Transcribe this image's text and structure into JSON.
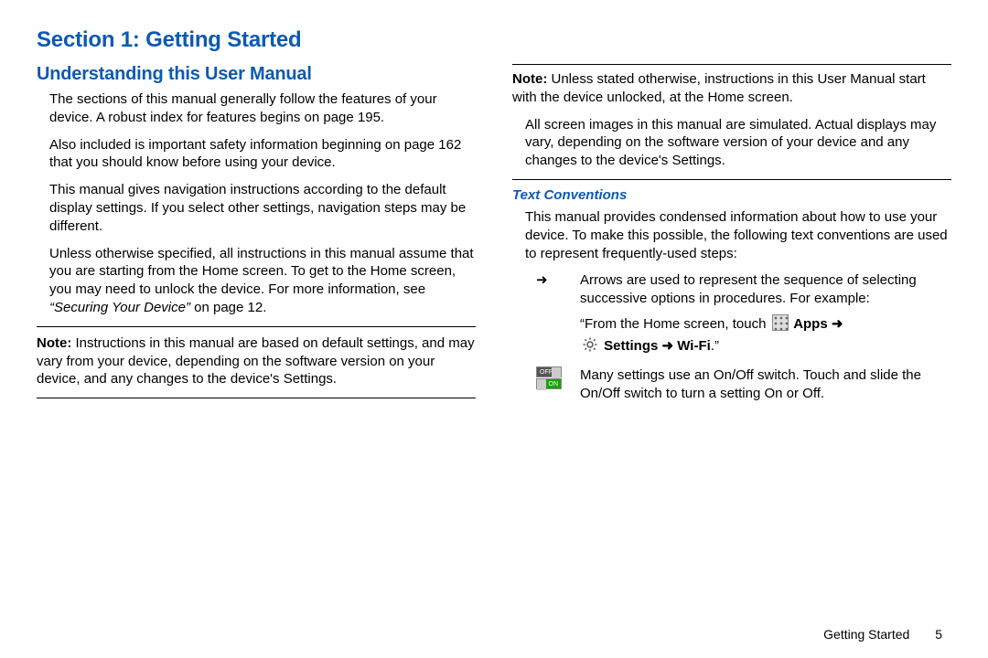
{
  "section_title": "Section 1: Getting Started",
  "left": {
    "heading": "Understanding this User Manual",
    "p1": "The sections of this manual generally follow the features of your device. A robust index for features begins on page 195.",
    "p2": "Also included is important safety information beginning on page 162 that you should know before using your device.",
    "p3": "This manual gives navigation instructions according to the default display settings. If you select other settings, navigation steps may be different.",
    "p4_a": "Unless otherwise specified, all instructions in this manual assume that you are starting from the Home screen. To get to the Home screen, you may need to unlock the device. For more information, see ",
    "p4_ref": "“Securing Your Device”",
    "p4_b": " on page 12.",
    "note_label": "Note:",
    "note_text": " Instructions in this manual are based on default settings, and may vary from your device, depending on the software version on your device, and any changes to the device's Settings."
  },
  "right": {
    "note_label": "Note:",
    "note2_text": " Unless stated otherwise, instructions in this User Manual start with the device unlocked, at the Home screen.",
    "p_sim": "All screen images in this manual are simulated. Actual displays may vary, depending on the software version of your device and any changes to the device's Settings.",
    "conv_heading": "Text Conventions",
    "conv_intro": "This manual provides condensed information about how to use your device. To make this possible, the following text conventions are used to represent frequently-used steps:",
    "arrow_sym": "➜",
    "arrow_text": "Arrows are used to represent the sequence of selecting successive options in procedures. For example:",
    "example_a": "“From the Home screen, touch ",
    "example_apps": " Apps ",
    "example_arrow1": "➜",
    "example_settings": " Settings ",
    "example_arrow2": "➜",
    "example_wifi": " Wi-Fi",
    "example_end": ".”",
    "switch_text": "Many settings use an On/Off switch. Touch and slide the On/Off switch to turn a setting On or Off.",
    "switch_off": "OFF",
    "switch_on": "ON"
  },
  "footer": {
    "chapter": "Getting Started",
    "page": "5"
  }
}
